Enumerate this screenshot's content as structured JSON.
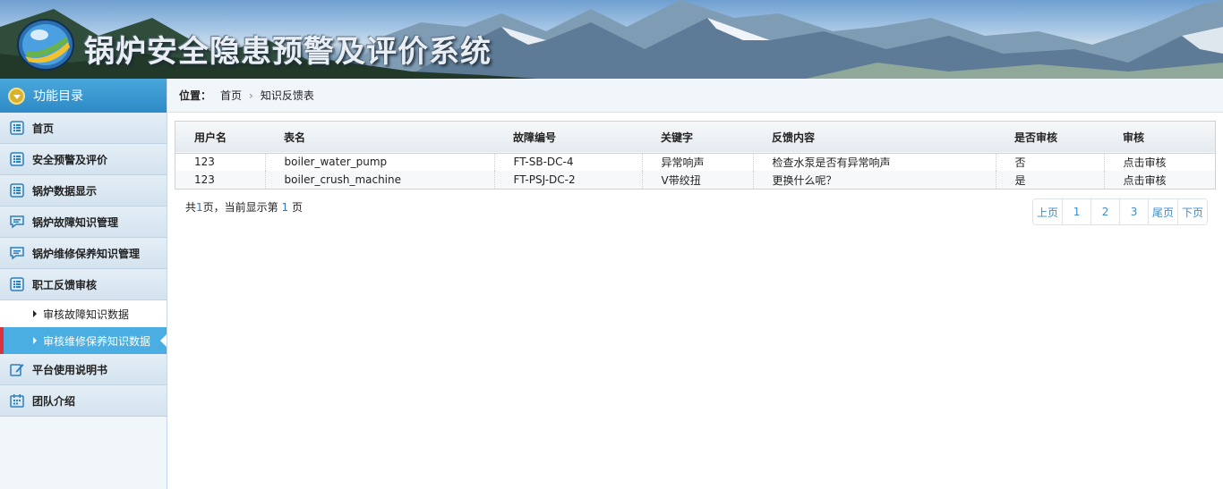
{
  "app": {
    "title": "锅炉安全隐患预警及评价系统"
  },
  "sidebar": {
    "header": "功能目录",
    "items": [
      {
        "label": "首页",
        "icon": "list-icon"
      },
      {
        "label": "安全预警及评价",
        "icon": "list-icon"
      },
      {
        "label": "锅炉数据显示",
        "icon": "list-icon"
      },
      {
        "label": "锅炉故障知识管理",
        "icon": "comment-icon"
      },
      {
        "label": "锅炉维修保养知识管理",
        "icon": "comment-icon"
      },
      {
        "label": "职工反馈审核",
        "icon": "list-icon"
      }
    ],
    "subitems": [
      {
        "label": "审核故障知识数据",
        "active": false
      },
      {
        "label": "审核维修保养知识数据",
        "active": true
      }
    ],
    "items_after": [
      {
        "label": "平台使用说明书",
        "icon": "edit-icon"
      },
      {
        "label": "团队介绍",
        "icon": "calendar-icon"
      }
    ]
  },
  "breadcrumb": {
    "label": "位置：",
    "home": "首页",
    "current": "知识反馈表"
  },
  "table": {
    "headers": [
      "用户名",
      "表名",
      "故障编号",
      "关键字",
      "反馈内容",
      "是否审核",
      "审核"
    ],
    "rows": [
      [
        "123",
        "boiler_water_pump",
        "FT-SB-DC-4",
        "异常响声",
        "检查水泵是否有异常响声",
        "否",
        "点击审核"
      ],
      [
        "123",
        "boiler_crush_machine",
        "FT-PSJ-DC-2",
        "V带绞扭",
        "更换什么呢？",
        "是",
        "点击审核"
      ]
    ]
  },
  "summary": {
    "prefix": "共",
    "total_pages": "1",
    "middle": "页，当前显示第 ",
    "current_page": "1",
    "suffix": " 页"
  },
  "pager": {
    "prev": "上页",
    "pages": [
      "1",
      "2",
      "3"
    ],
    "last": "尾页",
    "next": "下页"
  },
  "colors": {
    "accent": "#3d8cc8",
    "active_nav": "#4aaee2",
    "active_marker": "#d9333d"
  }
}
